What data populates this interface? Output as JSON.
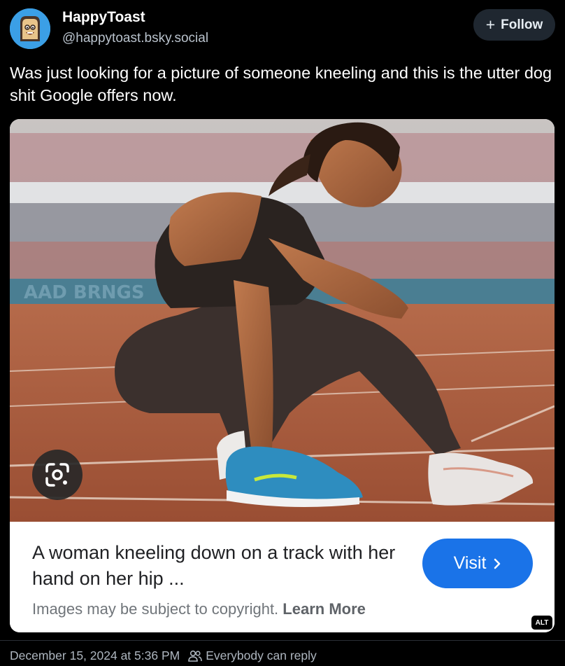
{
  "author": {
    "display_name": "HappyToast",
    "handle": "@happytoast.bsky.social",
    "avatar_icon": "toast-avatar-icon"
  },
  "follow": {
    "label": "Follow",
    "icon": "plus-icon"
  },
  "post": {
    "text": "Was just looking for a picture of someone kneeling and this is the utter dog shit Google offers now."
  },
  "embed": {
    "image_description": "AI-generated woman kneeling on running track",
    "caption": "A woman kneeling down on a track with her hand on her hip ...",
    "copyright_notice": "Images may be subject to copyright.",
    "learn_more": "Learn More",
    "visit_label": "Visit",
    "visit_icon": "chevron-right-icon",
    "lens_icon": "google-lens-icon",
    "alt_badge": "ALT"
  },
  "footer": {
    "timestamp": "December 15, 2024 at 5:36 PM",
    "reply_icon": "people-icon",
    "reply_setting": "Everybody can reply"
  },
  "colors": {
    "background": "#000000",
    "visit_button": "#1a73e8",
    "follow_button": "#1f2730",
    "avatar": "#3b9fe6"
  }
}
